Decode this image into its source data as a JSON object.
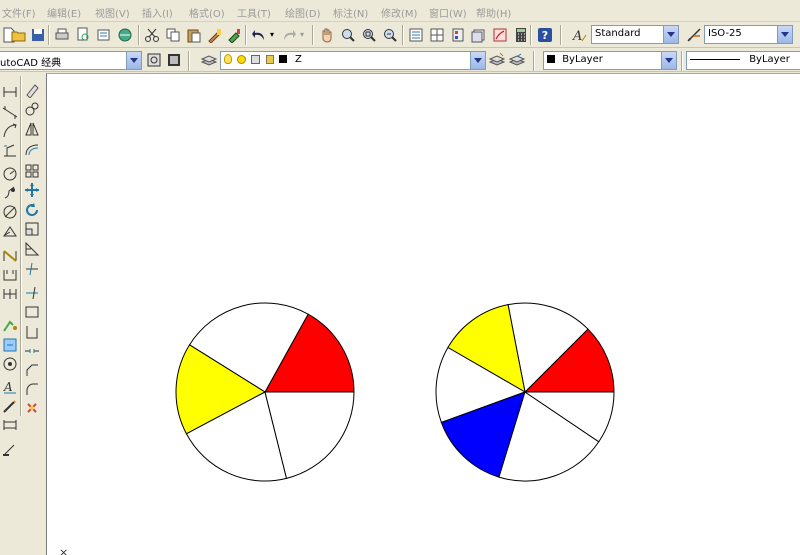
{
  "menu": [
    "文件(F)",
    "编辑(E)",
    "视图(V)",
    "插入(I)",
    "格式(O)",
    "工具(T)",
    "绘图(D)",
    "标注(N)",
    "修改(M)",
    "窗口(W)",
    "帮助(H)"
  ],
  "toolbar_styles": {
    "text_style": "Standard",
    "dim_style": "ISO-25"
  },
  "toolbar_layers": {
    "workspace": "utoCAD 经典",
    "layer_name": "Z",
    "color": "ByLayer",
    "linetype": "ByLayer"
  },
  "icons": {
    "standard": [
      "new-icon",
      "open-icon",
      "save-icon",
      "print-icon",
      "preview-icon",
      "publish-icon",
      "3dwf-icon",
      "cut-icon",
      "copy-icon",
      "paste-icon",
      "match-properties-icon",
      "block-editor-icon",
      "undo-icon",
      "redo-icon",
      "pan-icon",
      "zoom-realtime-icon",
      "zoom-window-icon",
      "zoom-previous-icon",
      "properties-icon",
      "design-center-icon",
      "tool-palettes-icon",
      "sheet-set-icon",
      "markup-icon",
      "quickcalc-icon",
      "help-icon"
    ],
    "draw": [
      "line-icon",
      "construction-line-icon",
      "polyline-icon",
      "polygon-icon",
      "rectangle-icon",
      "arc-icon",
      "circle-icon",
      "revision-cloud-icon",
      "spline-icon",
      "ellipse-icon",
      "insert-block-icon",
      "make-block-icon",
      "point-icon",
      "hatch-icon",
      "gradient-icon",
      "region-icon",
      "table-icon",
      "multiline-text-icon"
    ],
    "modify": [
      "erase-icon",
      "copy-object-icon",
      "mirror-icon",
      "offset-icon",
      "array-icon",
      "move-icon",
      "rotate-icon",
      "scale-icon",
      "stretch-icon",
      "trim-icon",
      "extend-icon",
      "break-at-point-icon",
      "break-icon",
      "join-icon",
      "chamfer-icon",
      "fillet-icon",
      "explode-icon"
    ]
  },
  "colors": {
    "red": "#ff0000",
    "yellow": "#ffff00",
    "blue": "#0000ff",
    "white": "#ffffff",
    "outline": "#000000"
  },
  "drawing": {
    "pie_left": {
      "boundaries_deg": [
        0,
        61,
        148,
        208,
        284,
        360
      ],
      "fills": [
        "red",
        "white",
        "yellow",
        "white",
        "white"
      ]
    },
    "pie_right": {
      "boundaries_deg": [
        0,
        45,
        101,
        150,
        200,
        253,
        326,
        360
      ],
      "fills": [
        "red",
        "white",
        "yellow",
        "white",
        "blue",
        "white",
        "white"
      ]
    }
  }
}
